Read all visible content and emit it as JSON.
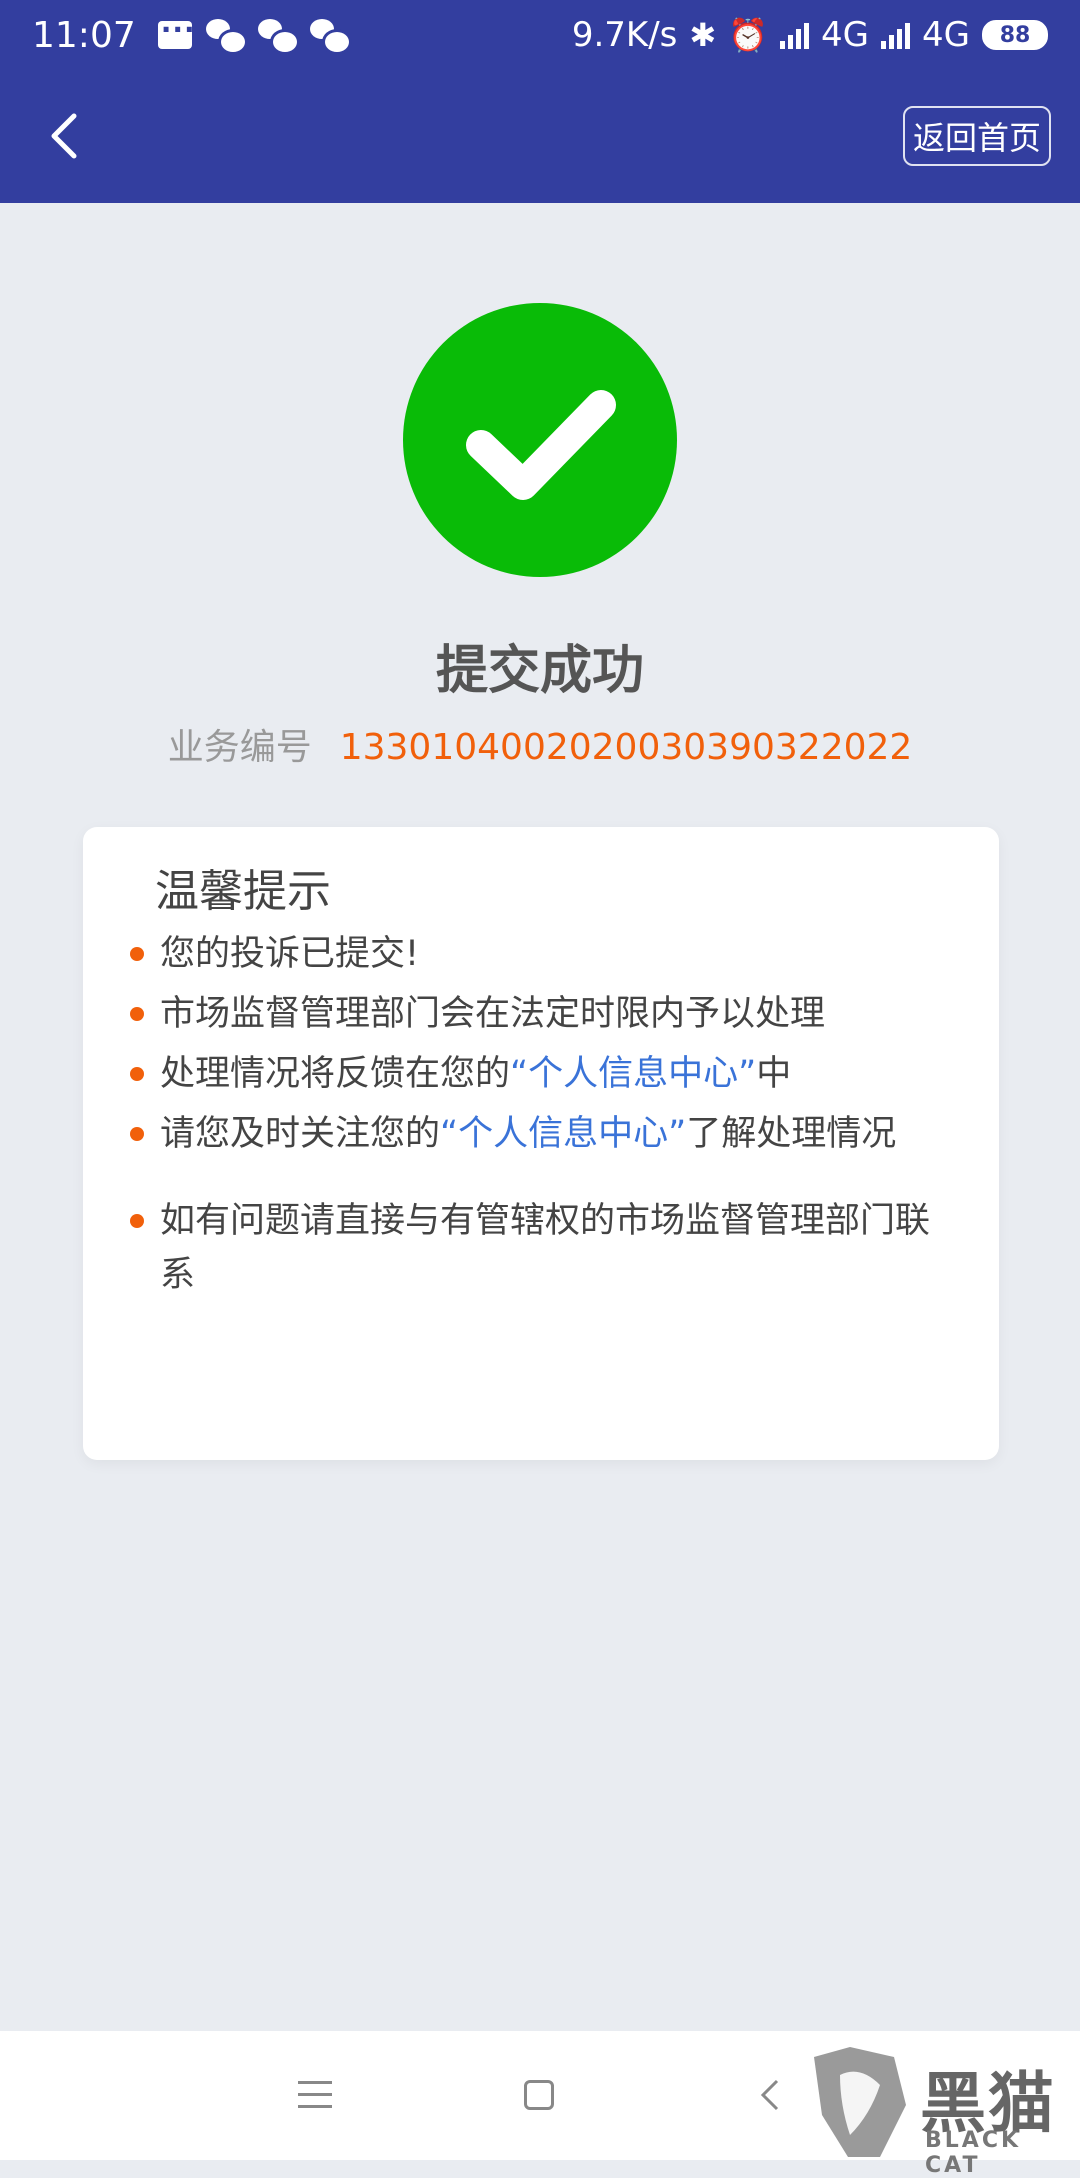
{
  "status_bar": {
    "time": "11:07",
    "net_speed": "9.7K/s",
    "network1": "4G",
    "network2": "4G",
    "battery": "88"
  },
  "header": {
    "home_button": "返回首页"
  },
  "result": {
    "title": "提交成功",
    "business_label": "业务编号",
    "business_number": "133010400202003039032202 2"
  },
  "tips": {
    "title": "温馨提示",
    "items": [
      {
        "before": "您的投诉已提交!",
        "highlight": "",
        "after": ""
      },
      {
        "before": "市场监督管理部门会在法定时限内予以处理",
        "highlight": "",
        "after": ""
      },
      {
        "before": "处理情况将反馈在您的",
        "highlight": "“个人信息中心”",
        "after": "中"
      },
      {
        "before": "请您及时关注您的",
        "highlight": "“个人信息中心”",
        "after": "了解处理情况"
      },
      {
        "before": "如有问题请直接与有管辖权的市场监督管理部门联系",
        "highlight": "",
        "after": ""
      }
    ]
  },
  "watermark": {
    "text": "黑猫",
    "sub": "BLACK CAT"
  },
  "colors": {
    "header": "#333e9f",
    "success": "#09bb07",
    "accent": "#f1600b",
    "link": "#3a73d8"
  }
}
